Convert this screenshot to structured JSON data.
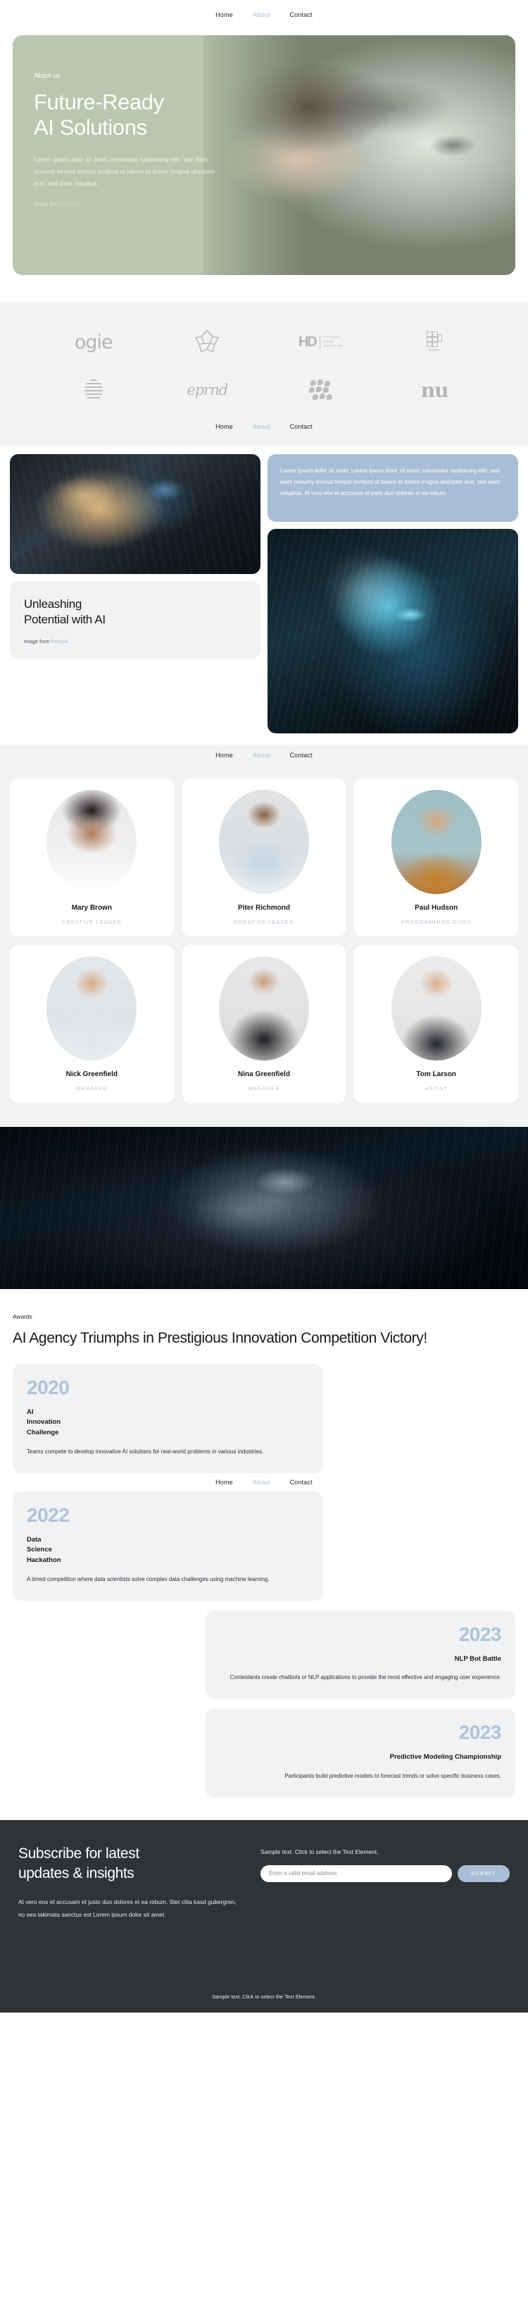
{
  "nav": {
    "items": [
      {
        "label": "Home",
        "state": "active"
      },
      {
        "label": "About",
        "state": "muted"
      },
      {
        "label": "Contact",
        "state": "normal"
      }
    ]
  },
  "hero": {
    "eyebrow": "About us",
    "title_line1": "Future-Ready",
    "title_line2": "AI Solutions",
    "paragraph": "Lorem ipsum dolor sit amet, consetetur sadipscing elitr, sed diam nonumy eirmod tempor invidunt ut labore et dolore magna aliquyam erat, sed diam voluptua.",
    "credit_prefix": "Image from ",
    "credit_link": "Freepik",
    "bg_color": "#b9c7ae"
  },
  "logos": {
    "items": [
      {
        "name": "ogie",
        "type": "wordmark"
      },
      {
        "name": "flower-mark",
        "type": "mark"
      },
      {
        "name": "HD",
        "sub": "HOLISTIC\nLIFES\nDIRECTION",
        "type": "wordmark-sub"
      },
      {
        "name": "brighto",
        "type": "blocks"
      },
      {
        "name": "striped-circle",
        "type": "mark"
      },
      {
        "name": "eprnd",
        "type": "wordmark"
      },
      {
        "name": "dots-mark",
        "type": "mark"
      },
      {
        "name": "nu",
        "type": "wordmark"
      }
    ],
    "bg_color": "#f2f3f3"
  },
  "showcase": {
    "blue_card_text": "Lorem ipsum dolor sit amet. Lorem ipsum dolor sit amet, consetetur sadipscing elitr, sed diam nonumy eirmod tempor invidunt ut labore et dolore magna aliquyam erat, sed diam voluptua. At vero eos et accusam et justo duo dolores et ea rebum.",
    "blue_card_color": "#a8bed6",
    "unleash_title_line1": "Unleashing",
    "unleash_title_line2": "Potential with AI",
    "credit_prefix": "Image from ",
    "credit_link": "Freepik"
  },
  "team": {
    "members": [
      {
        "name": "Mary Brown",
        "role": "CREATIVE LEADER"
      },
      {
        "name": "Piter Richmond",
        "role": "CREATIVE LEADER"
      },
      {
        "name": "Paul Hudson",
        "role": "PROGRAMMING GURU"
      },
      {
        "name": "Nick Greenfield",
        "role": "MANAGER"
      },
      {
        "name": "Nina Greenfield",
        "role": "MANAGER"
      },
      {
        "name": "Tom Larson",
        "role": "ARTIST"
      }
    ],
    "role_color": "#b8c6d6"
  },
  "awards": {
    "eyebrow": "Awards",
    "title": "AI Agency Triumphs in Prestigious Innovation Competition Victory!",
    "year_color": "#aec3d8",
    "cards": [
      {
        "year": "2020",
        "name": "AI\nInnovation\nChallenge",
        "desc": "Teams compete to develop innovative AI solutions for real-world problems in various industries.",
        "align": "left"
      },
      {
        "year": "2022",
        "name": "Data\nScience\nHackathon",
        "desc": "A timed competition where data scientists solve complex data challenges using machine learning.",
        "align": "left"
      },
      {
        "year": "2023",
        "name": "NLP Bot Battle",
        "desc": "Contestants create chatbots or NLP applications to provide the most effective and engaging user experience.",
        "align": "right"
      },
      {
        "year": "2023",
        "name": "Predictive Modeling Championship",
        "desc": "Participants build predictive models to forecast trends or solve specific business cases.",
        "align": "right"
      }
    ]
  },
  "subscribe": {
    "title_line1": "Subscribe for latest",
    "title_line2": "updates & insights",
    "paragraph": "At vero eos et accusam et justo duo dolores et ea rebum. Stet clita kasd gubergren, no sea takimata sanctus est Lorem ipsum dolor sit amet.",
    "note": "Sample text. Click to select the Text Element.",
    "email_placeholder": "Enter a valid email address",
    "email_value": "",
    "submit_label": "SUBMIT",
    "footer_text": "Sample text. Click to select the Text Element.",
    "bg_color": "#2f3336",
    "accent_color": "#a8bed6"
  }
}
